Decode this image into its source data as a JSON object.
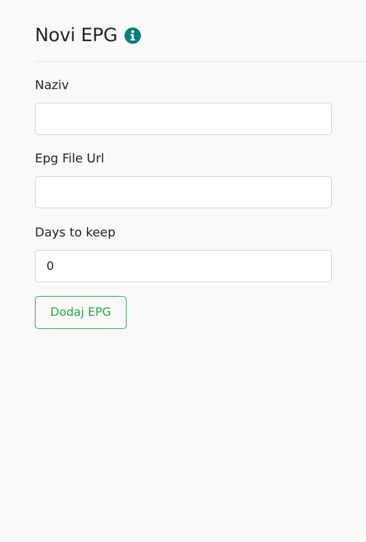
{
  "header": {
    "title": "Novi EPG",
    "info_icon": "info-circle-icon",
    "accent_color": "#0c7e7a"
  },
  "form": {
    "fields": [
      {
        "label": "Naziv",
        "value": "",
        "placeholder": ""
      },
      {
        "label": "Epg File Url",
        "value": "",
        "placeholder": ""
      },
      {
        "label": "Days to keep",
        "value": "0",
        "placeholder": ""
      }
    ],
    "submit_label": "Dodaj EPG",
    "submit_color": "#28a745"
  }
}
